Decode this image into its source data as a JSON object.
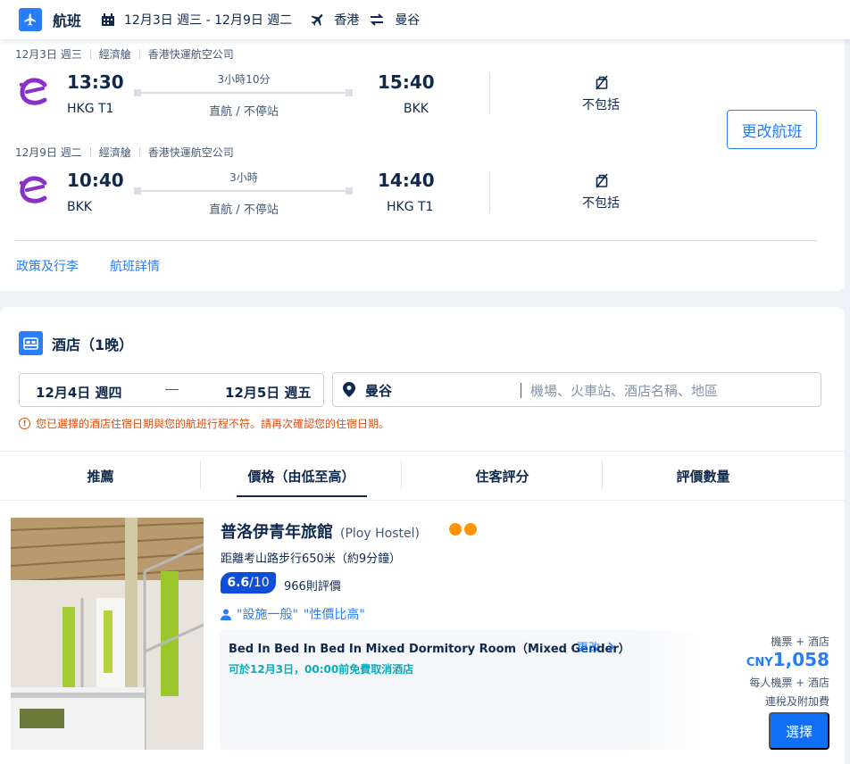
{
  "flight": {
    "section_title": "航班",
    "dates": "12月3日 週三 - 12月9日 週二",
    "origin": "香港",
    "destination": "曼谷",
    "segments": [
      {
        "date": "12月3日 週三",
        "cabin": "經濟艙",
        "airline": "香港快運航空公司",
        "dep_time": "13:30",
        "dep_airport": "HKG T1",
        "duration": "3小時10分",
        "stops": "直航 / 不停站",
        "arr_time": "15:40",
        "arr_airport": "BKK",
        "baggage": "不包括"
      },
      {
        "date": "12月9日 週二",
        "cabin": "經濟艙",
        "airline": "香港快運航空公司",
        "dep_time": "10:40",
        "dep_airport": "BKK",
        "duration": "3小時",
        "stops": "直航 / 不停站",
        "arr_time": "14:40",
        "arr_airport": "HKG T1",
        "baggage": "不包括"
      }
    ],
    "change_button": "更改航班",
    "links": [
      "政策及行李",
      "航班詳情"
    ]
  },
  "hotel": {
    "section_title": "酒店（1晚）",
    "checkin": "12月4日 週四",
    "checkout": "12月5日 週五",
    "city": "曼谷",
    "search_placeholder": "機場、火車站、酒店名稱、地區",
    "warning": "您已選擇的酒店住宿日期與您的航班行程不符。請再次確認您的住宿日期。",
    "sort_tabs": [
      "推薦",
      "價格（由低至高）",
      "住客評分",
      "評價數量"
    ],
    "active_sort_index": 1,
    "listing": {
      "name": "普洛伊青年旅館",
      "name_en": "(Ploy Hostel)",
      "rating_dots": 2,
      "distance": "距離考山路步行650米（約9分鐘）",
      "score": "6.6",
      "score_max": "/10",
      "reviews": "966則評價",
      "tags": [
        "\"設施一般\"",
        "\"性價比高\""
      ],
      "room_name": "Bed In Bed In Bed In Mixed Dormitory Room（Mixed Gender）",
      "room_change": "更改",
      "cancellation": "可於12月3日，00:00前免費取消酒店",
      "price_label": "機票 + 酒店",
      "currency": "CNY",
      "price": "1,058",
      "price_note_1": "每人機票 + 酒店",
      "price_note_2": "連稅及附加費",
      "select_button": "選擇"
    }
  },
  "colors": {
    "primary": "#287dfa",
    "text": "#0f294d",
    "warning": "#e34d0e",
    "teal": "#06aebd",
    "rating": "#ff9500",
    "airline_purple": "#8b2fc9"
  }
}
